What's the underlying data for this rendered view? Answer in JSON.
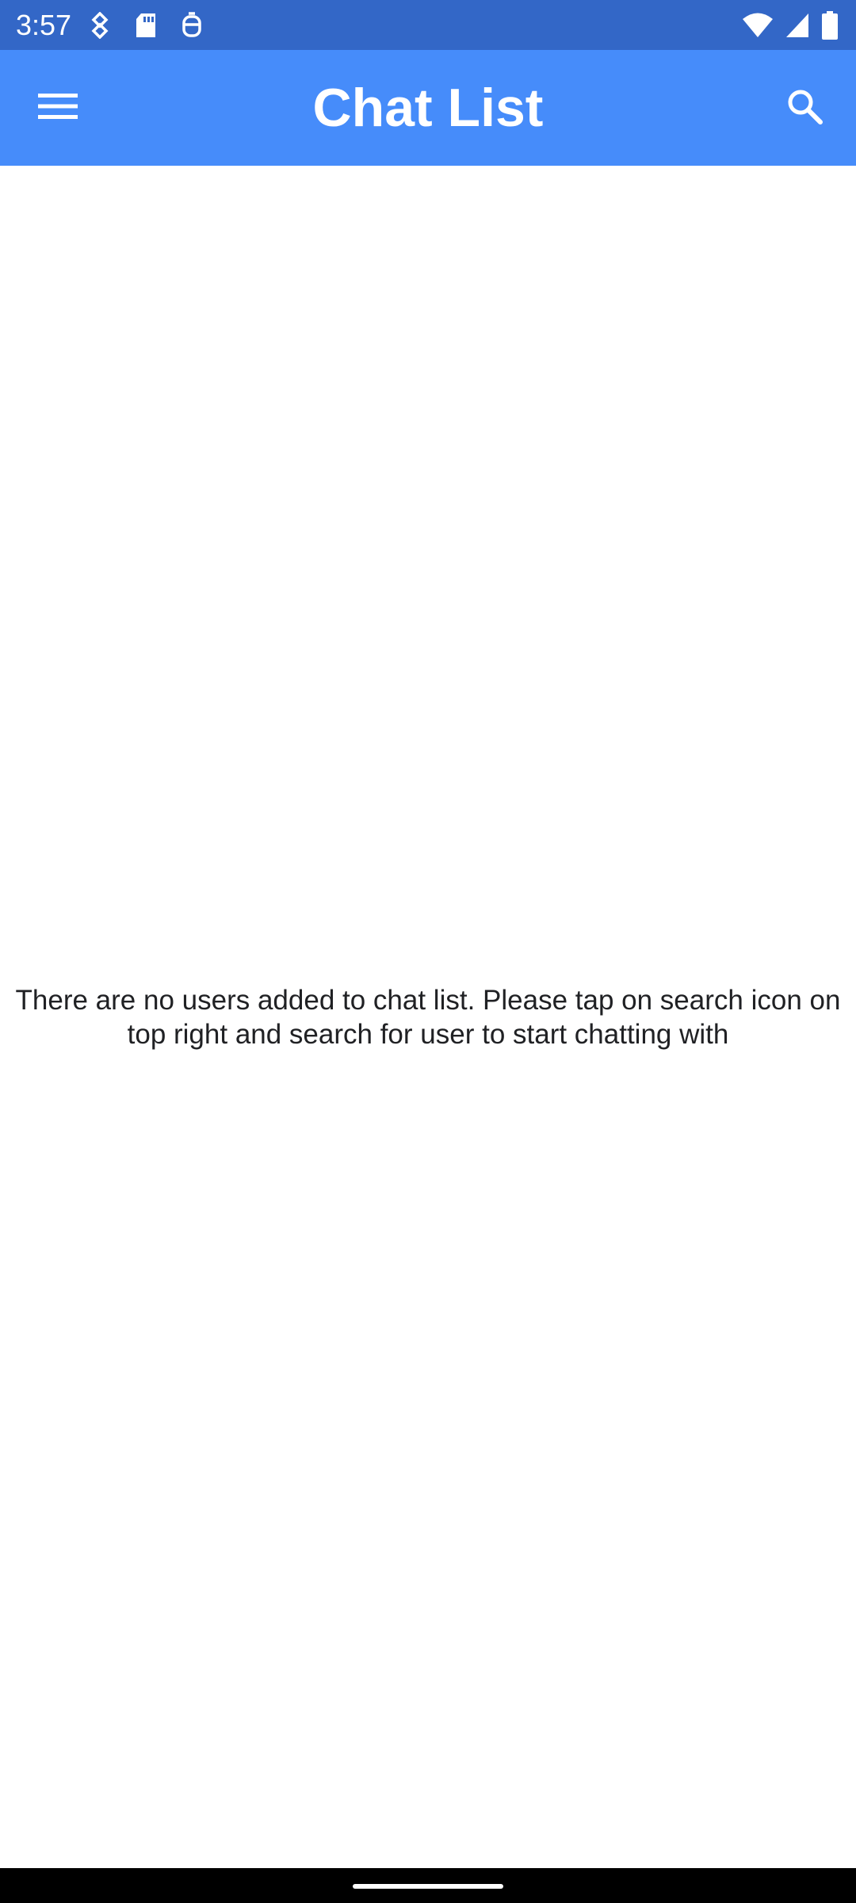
{
  "status_bar": {
    "time": "3:57",
    "left_icons": [
      "data-saver-icon",
      "sd-card-icon",
      "debug-icon"
    ],
    "right_icons": [
      "wifi-icon",
      "cell-signal-icon",
      "battery-icon"
    ],
    "background_color": "#3367c7"
  },
  "app_bar": {
    "title": "Chat List",
    "menu_icon": "hamburger-menu-icon",
    "search_icon": "search-icon",
    "background_color": "#468cfa"
  },
  "main": {
    "empty_message": "There are no users added to chat list. Please tap on search icon on top right and search for user to start chatting with"
  }
}
